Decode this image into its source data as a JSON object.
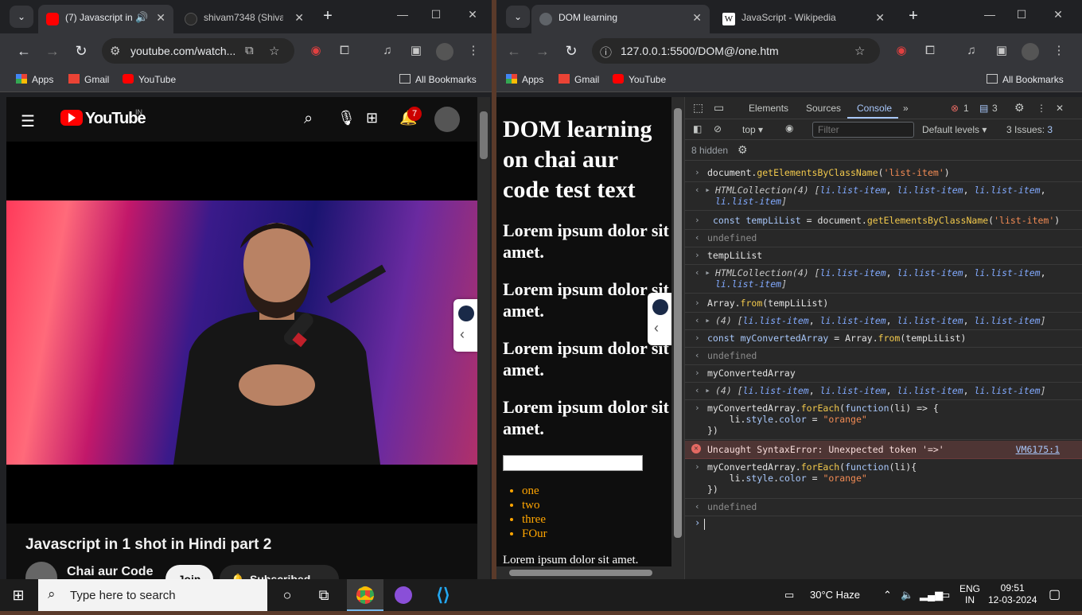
{
  "left_browser": {
    "tabs": [
      {
        "title": "(7) Javascript in",
        "active": true
      },
      {
        "title": "shivam7348 (Shivan",
        "active": false
      }
    ],
    "url": "youtube.com/watch...",
    "bookmarks": [
      "Apps",
      "Gmail",
      "YouTube"
    ],
    "all_bookmarks": "All Bookmarks",
    "youtube": {
      "logo_text": "YouTube",
      "region": "IN",
      "notifications_count": "7",
      "video_title": "Javascript in 1 shot in Hindi part 2",
      "channel": "Chai aur Code",
      "join_label": "Join",
      "subscribed_label": "Subscribed"
    }
  },
  "right_browser": {
    "tabs": [
      {
        "title": "DOM learning",
        "active": true
      },
      {
        "title": "JavaScript - Wikipedia",
        "active": false
      }
    ],
    "url": "127.0.0.1:5500/DOM@/one.htm",
    "bookmarks": [
      "Apps",
      "Gmail",
      "YouTube"
    ],
    "all_bookmarks": "All Bookmarks",
    "page": {
      "heading": "DOM learning on chai aur code test text",
      "subheadings": [
        "Lorem ipsum dolor sit amet.",
        "Lorem ipsum dolor sit amet.",
        "Lorem ipsum dolor sit amet.",
        "Lorem ipsum dolor sit amet."
      ],
      "list_items": [
        "one",
        "two",
        "three",
        "FOur"
      ],
      "paragraph": "Lorem ipsum dolor sit amet.",
      "list_color": "#ffa500"
    },
    "devtools": {
      "tabs": [
        "Elements",
        "Sources",
        "Console"
      ],
      "active_tab": "Console",
      "error_count": "1",
      "issue_count": "3",
      "context": "top",
      "filter_placeholder": "Filter",
      "levels": "Default levels",
      "issues_label": "3 Issues:",
      "issues_badge": "3",
      "hidden_label": "8 hidden",
      "error_message": "Uncaught SyntaxError: Unexpected token '=>'",
      "error_source": "VM6175:1",
      "undefined_text": "undefined"
    }
  },
  "taskbar": {
    "search_placeholder": "Type here to search",
    "weather": "30°C  Haze",
    "language": "ENG",
    "region": "IN",
    "time": "09:51",
    "date": "12-03-2024"
  }
}
